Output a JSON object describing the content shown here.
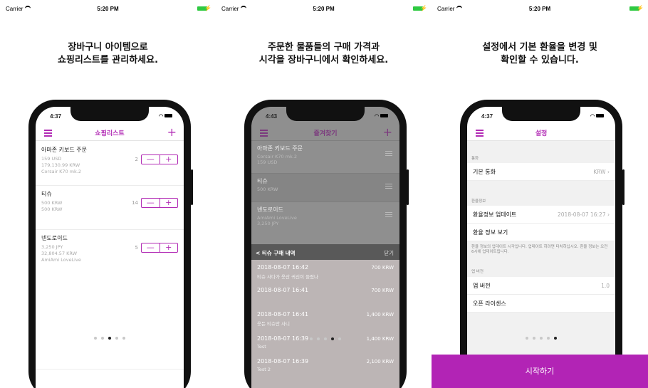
{
  "status": {
    "carrier": "Carrier",
    "time": "5:20 PM"
  },
  "panel1": {
    "caption_line1": "장바구니 아이템으로",
    "caption_line2": "쇼핑리스트를 관리하세요.",
    "phone_time": "4:37",
    "nav_title": "쇼핑리스트",
    "items": [
      {
        "name": "아마존 키보드 주문",
        "line1": "159 USD",
        "line2": "179,130.99 KRW",
        "line3": "Corsair K70 mk.2",
        "qty": "2"
      },
      {
        "name": "티슈",
        "line1": "500 KRW",
        "line2": "500 KRW",
        "line3": "",
        "qty": "14"
      },
      {
        "name": "넨도로이드",
        "line1": "3,250 JPY",
        "line2": "32,804.57 KRW",
        "line3": "AmiAmi LoveLive",
        "qty": "5"
      }
    ],
    "stepper": {
      "minus": "—",
      "plus": "+"
    },
    "page_index": 3
  },
  "panel2": {
    "caption_line1": "주문한 물품들의 구매 가격과",
    "caption_line2": "시각을 장바구니에서 확인하세요.",
    "phone_time": "4:43",
    "nav_title": "즐겨찾기",
    "items": [
      {
        "name": "아마존 키보드 주문",
        "line1": "Corsair K70 mk.2",
        "line2": "159 USD"
      },
      {
        "name": "티슈",
        "line1": "500 KRW",
        "line2": ""
      },
      {
        "name": "넨도로이드",
        "line1": "AmiAmi LoveLive",
        "line2": "3,250 JPY"
      }
    ],
    "sheet_title": "< 티슈 구매 내역",
    "sheet_close": "닫기",
    "logs": [
      {
        "date": "2018-08-07 16:42",
        "amount": "700 KRW",
        "memo": "티슈 사다가 웃산 귀신이 들렸나"
      },
      {
        "date": "2018-08-07 16:41",
        "amount": "700 KRW",
        "memo": ""
      },
      {
        "date": "2018-08-07 16:41",
        "amount": "1,400 KRW",
        "memo": "웃든 티슈만 사니"
      },
      {
        "date": "2018-08-07 16:39",
        "amount": "1,400 KRW",
        "memo": "Test"
      },
      {
        "date": "2018-08-07 16:39",
        "amount": "2,100 KRW",
        "memo": "Test 2"
      }
    ],
    "page_index": 4
  },
  "panel3": {
    "caption_line1": "설정에서 기본 환율을 변경 및",
    "caption_line2": "확인할 수 있습니다.",
    "phone_time": "4:37",
    "nav_title": "설정",
    "sec_currency": "통화",
    "default_currency_label": "기본 통화",
    "default_currency_value": "KRW",
    "sec_rate": "환율정보",
    "rate_update_label": "환율정보 업데이트",
    "rate_update_value": "2018-08-07 16:27",
    "rate_view_label": "환율 정보 보기",
    "rate_note": "환율 정보의 업데이트 시각입니다. 업데이트 하려면 터치하십시오. 환율 정보는 오전 6시에 업데이트됩니다.",
    "sec_version": "앱 버전",
    "app_version_label": "앱 버전",
    "app_version_value": "1.0",
    "license_label": "오픈 라이센스",
    "page_index": 5,
    "cta_label": "시작하기"
  },
  "colors": {
    "accent": "#b22bb5",
    "cta": "#b224b5",
    "battery": "#2ec941"
  },
  "icons": [
    "wifi-icon",
    "battery-icon",
    "menu-icon",
    "plus-icon",
    "chevron-right-icon",
    "drag-handle-icon"
  ]
}
